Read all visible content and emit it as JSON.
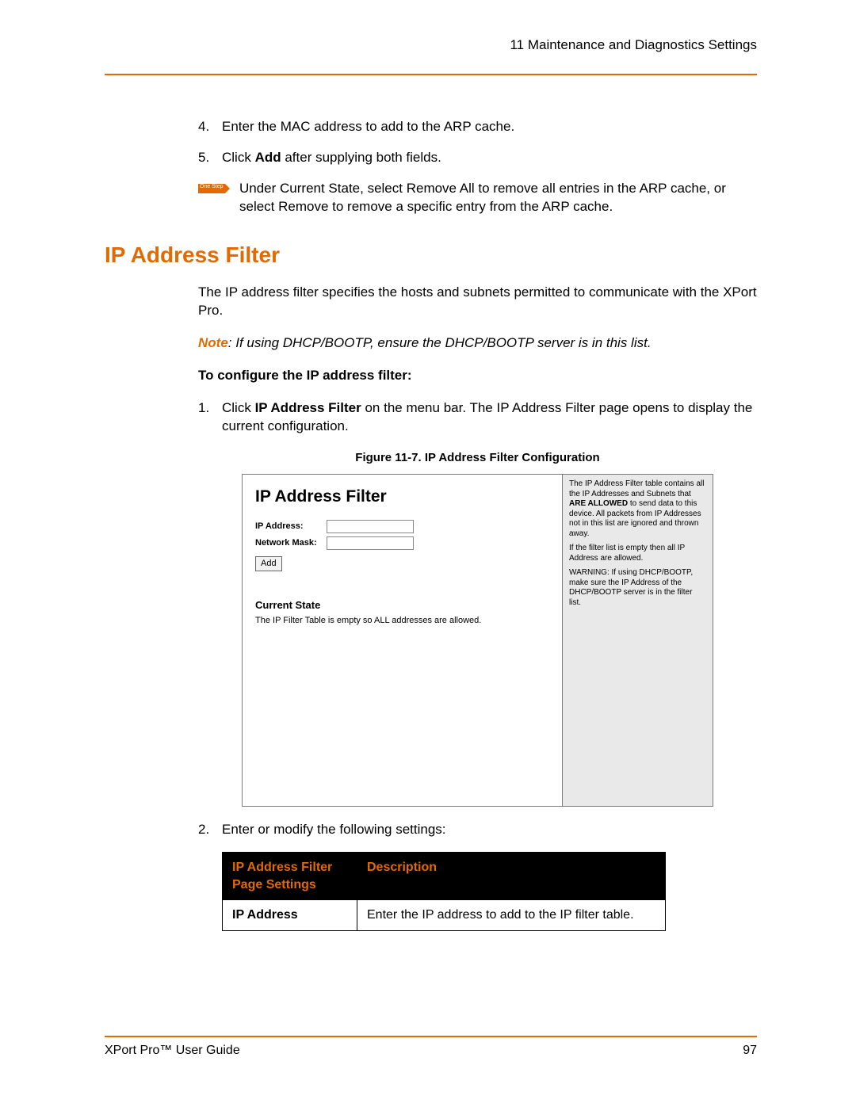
{
  "header": {
    "chapter": "11  Maintenance and Diagnostics Settings"
  },
  "prev_steps": {
    "four_num": "4.",
    "four": "Enter the MAC address to add to the ARP cache.",
    "five_num": "5.",
    "five_pre": "Click ",
    "five_bold": "Add",
    "five_post": " after supplying both fields.",
    "chip_label": "One Step",
    "tip": "Under Current State, select Remove All to remove all entries in the ARP cache, or select Remove to remove a specific entry from the ARP cache."
  },
  "section": {
    "title": "IP Address Filter",
    "intro": "The IP address filter specifies the hosts and subnets permitted to communicate with the XPort Pro.",
    "note_label": "Note",
    "note_text": ": If using DHCP/BOOTP, ensure the DHCP/BOOTP server is in this list.",
    "configure_head": "To configure the IP address filter:",
    "step1_num": "1.",
    "step1_pre": "Click ",
    "step1_bold": "IP Address Filter",
    "step1_post": " on the menu bar. The IP Address Filter page opens to display the current configuration.",
    "fig_caption": "Figure 11-7. IP Address Filter Configuration",
    "step2_num": "2.",
    "step2": "Enter or modify the following settings:"
  },
  "mock": {
    "title": "IP Address Filter",
    "ip_label": "IP Address:",
    "mask_label": "Network Mask:",
    "add_btn": "Add",
    "current_state": "Current State",
    "state_text": "The IP Filter Table is empty so ALL addresses are allowed.",
    "right_p1a": "The IP Address Filter table contains all the IP Addresses and Subnets that ",
    "right_p1b": "ARE ALLOWED",
    "right_p1c": " to send data to this device. All packets from IP Addresses not in this list are ignored and thrown away.",
    "right_p2": "If the filter list is empty then all IP Address are allowed.",
    "right_p3": "WARNING: If using DHCP/BOOTP, make sure the IP Address of the DHCP/BOOTP server is in the filter list."
  },
  "table": {
    "h1": "IP Address Filter Page Settings",
    "h2": "Description",
    "r1c1": "IP Address",
    "r1c2": "Enter the IP address to add to the IP filter table."
  },
  "footer": {
    "left": "XPort Pro™ User Guide",
    "right": "97"
  }
}
